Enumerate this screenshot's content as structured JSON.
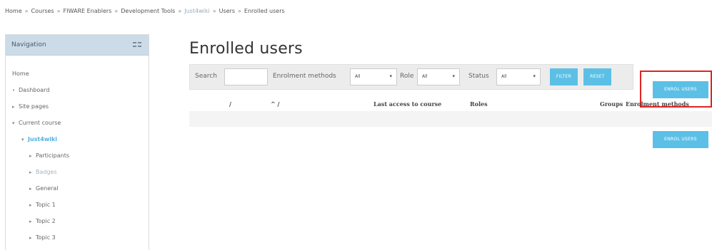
{
  "breadcrumb": {
    "items": [
      "Home",
      "Courses",
      "FIWARE Enablers",
      "Development Tools",
      "Just4wiki",
      "Users",
      "Enrolled users"
    ],
    "separator": "»"
  },
  "navigation": {
    "title": "Navigation",
    "items": [
      {
        "label": "Home",
        "arrow": ""
      },
      {
        "label": "Dashboard",
        "arrow": "•"
      },
      {
        "label": "Site pages",
        "arrow": "▸"
      },
      {
        "label": "Current course",
        "arrow": "▾"
      },
      {
        "label": "Just4wiki",
        "arrow": "▾"
      },
      {
        "label": "Participants",
        "arrow": "▸"
      },
      {
        "label": "Badges",
        "arrow": "▸"
      },
      {
        "label": "General",
        "arrow": "▸"
      },
      {
        "label": "Topic 1",
        "arrow": "▸"
      },
      {
        "label": "Topic 2",
        "arrow": "▸"
      },
      {
        "label": "Topic 3",
        "arrow": "▸"
      }
    ]
  },
  "page": {
    "title": "Enrolled users"
  },
  "filters": {
    "search_label": "Search",
    "search_value": "",
    "enrolment_label": "Enrolment methods",
    "enrolment_value": "All",
    "role_label": "Role",
    "role_value": "All",
    "status_label": "Status",
    "status_value": "All",
    "filter_button": "FILTER",
    "reset_button": "RESET"
  },
  "actions": {
    "enrol_top": "ENROL USERS",
    "enrol_bottom": "ENROL USERS"
  },
  "table": {
    "headers": [
      "/",
      "^ /",
      "Last access to course",
      "Roles",
      "Groups",
      "Enrolment methods"
    ]
  },
  "colors": {
    "accent": "#5cc0e6",
    "highlight": "#e02424",
    "nav_header": "#cbdbe8"
  }
}
